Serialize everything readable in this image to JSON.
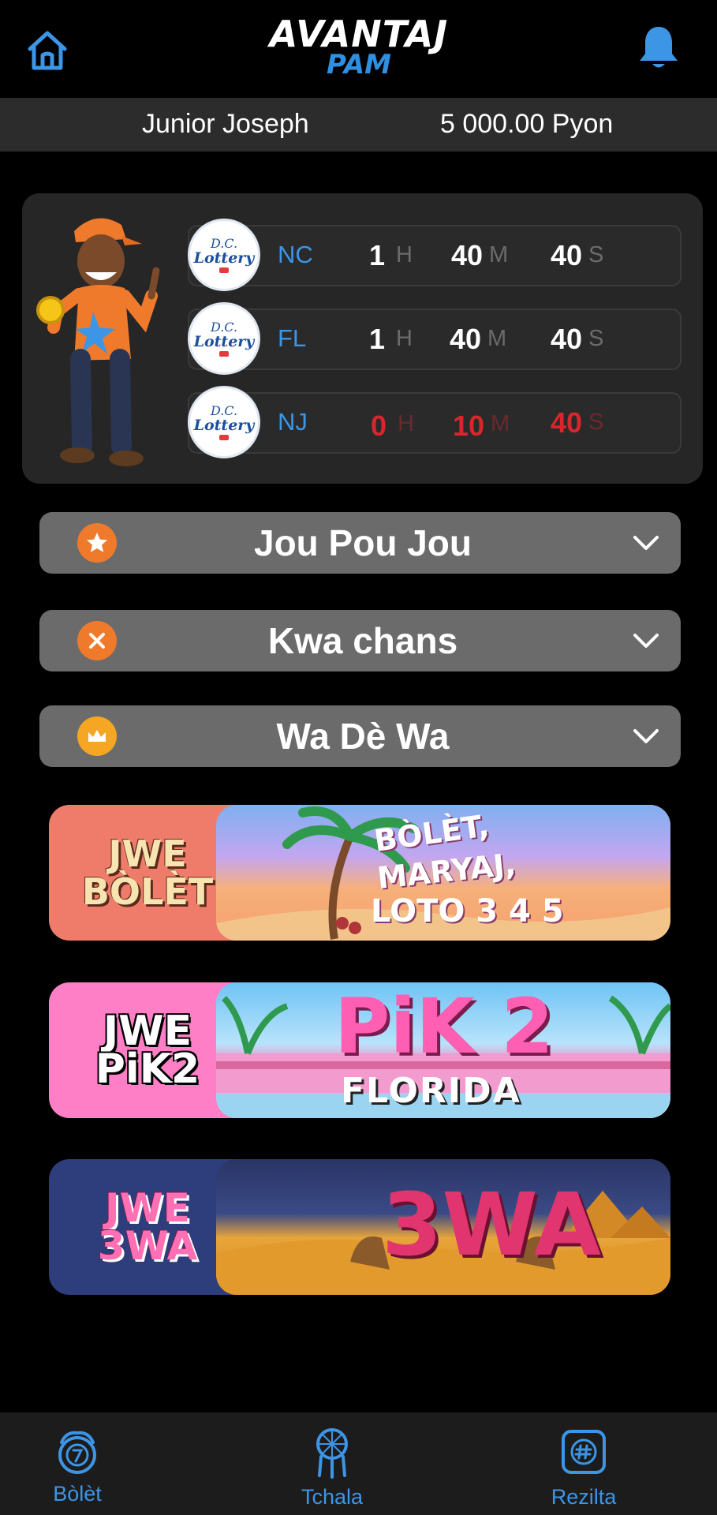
{
  "header": {
    "home_icon": "home-icon",
    "bell_icon": "bell-icon",
    "logo_main": "AVANTAJ",
    "logo_sub": "PAM"
  },
  "user": {
    "name": "Junior Joseph",
    "balance": "5 000.00 Pyon"
  },
  "countdown": {
    "rows": [
      {
        "badge_top": "D.C.",
        "badge_word": "Lottery",
        "state": "NC",
        "hours": "1",
        "hours_unit": "H",
        "minutes": "40",
        "minutes_unit": "M",
        "seconds": "40",
        "seconds_unit": "S",
        "urgent": false
      },
      {
        "badge_top": "D.C.",
        "badge_word": "Lottery",
        "state": "FL",
        "hours": "1",
        "hours_unit": "H",
        "minutes": "40",
        "minutes_unit": "M",
        "seconds": "40",
        "seconds_unit": "S",
        "urgent": false
      },
      {
        "badge_top": "D.C.",
        "badge_word": "Lottery",
        "state": "NJ",
        "hours": "0",
        "hours_unit": "H",
        "minutes": "10",
        "minutes_unit": "M",
        "seconds": "40",
        "seconds_unit": "S",
        "urgent": true
      }
    ]
  },
  "accordions": [
    {
      "label": "Jou Pou Jou",
      "icon": "star-icon",
      "icon_color": "#f07a2c"
    },
    {
      "label": "Kwa chans",
      "icon": "x-icon",
      "icon_color": "#f07a2c"
    },
    {
      "label": "Wa Dè Wa",
      "icon": "crown-icon",
      "icon_color": "#f5a623"
    }
  ],
  "banners": [
    {
      "tag_line1": "JWE",
      "tag_line2": "BÒLÈT",
      "art_line1": "BÒLÈT,",
      "art_line2": "MARYAJ,",
      "art_line3": "LOTO 3 4 5"
    },
    {
      "tag_line1": "JWE",
      "tag_line2": "PiK2",
      "art_line1": "PiK 2",
      "art_line2": "FLORIDA"
    },
    {
      "tag_line1": "JWE",
      "tag_line2": "3WA",
      "art_line1": "3WA"
    }
  ],
  "nav": {
    "items": [
      {
        "label": "Bòlèt",
        "icon": "lottery-ball-icon"
      },
      {
        "label": "Tchala",
        "icon": "dreamcatcher-icon"
      },
      {
        "label": "Rezilta",
        "icon": "results-icon"
      }
    ]
  },
  "colors": {
    "accent_blue": "#3d95e6",
    "urgent_red": "#d9262c",
    "orange": "#f07a2c"
  }
}
